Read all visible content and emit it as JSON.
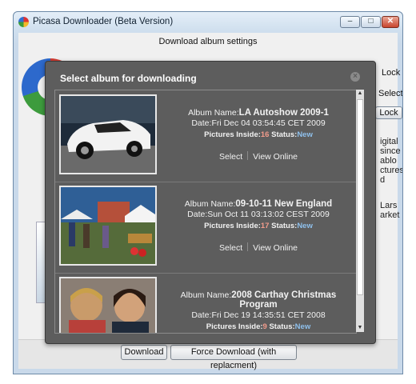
{
  "window": {
    "title": "Picasa Downloader (Beta Version)",
    "min": "–",
    "max": "□",
    "close": "✕"
  },
  "settings": {
    "title": "Download album settings",
    "lock_label": "Lock",
    "select_label": "Select",
    "lock_button": "Lock",
    "desc_lines": [
      "igital",
      "since",
      "ablo",
      "ctures",
      "d"
    ],
    "author_lines": [
      "Lars",
      "arket"
    ]
  },
  "dialog": {
    "title": "Select album for downloading",
    "close_icon": "close-icon",
    "albums": [
      {
        "name_label": "Album Name:",
        "name": "LA Autoshow 2009-1",
        "date_label": "Date:",
        "date": "Fri Dec 04 03:54:45 CET 2009",
        "pics_label": "Pictures Inside:",
        "pics": "16",
        "status_label": "Status:",
        "status": "New",
        "select": "Select",
        "view": "View Online"
      },
      {
        "name_label": "Album Name:",
        "name": "09-10-11 New England",
        "date_label": "Date:",
        "date": "Sun Oct 11 03:13:02 CEST 2009",
        "pics_label": "Pictures Inside:",
        "pics": "17",
        "status_label": "Status:",
        "status": "New",
        "select": "Select",
        "view": "View Online"
      },
      {
        "name_label": "Album Name:",
        "name": "2008 Carthay Christmas Program",
        "date_label": "Date:",
        "date": "Fri Dec 19 14:35:51 CET 2008",
        "pics_label": "Pictures Inside:",
        "pics": "9",
        "status_label": "Status:",
        "status": "New"
      }
    ]
  },
  "buttons": {
    "download": "Download",
    "force": "Force Download (with replacment)"
  },
  "colors": {
    "dialog_bg": "#5d5d5d",
    "count": "#f39c8c",
    "status_new": "#8fc0ec"
  }
}
